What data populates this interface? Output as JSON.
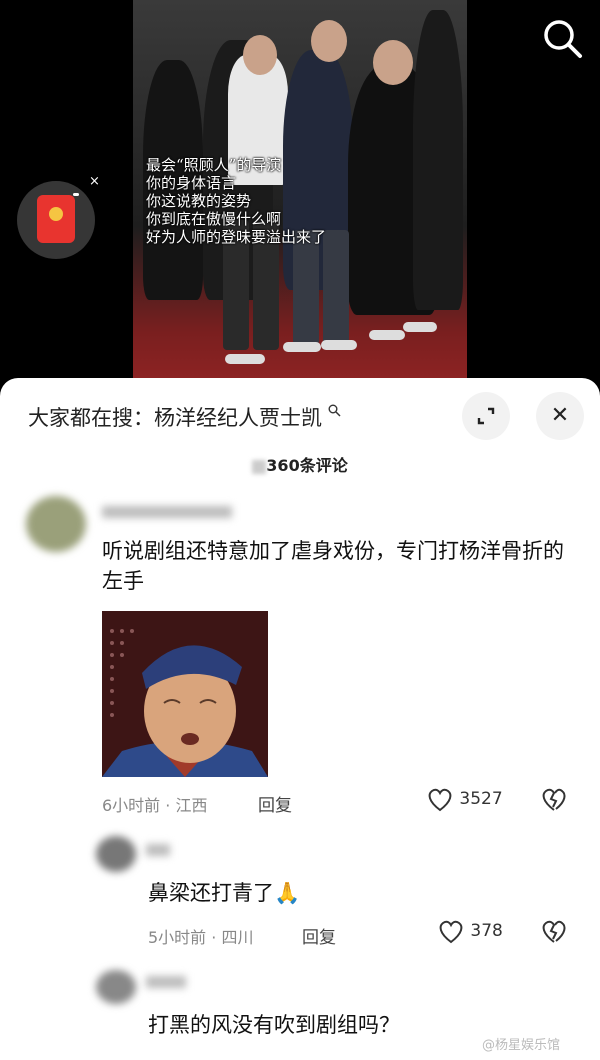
{
  "video": {
    "caption_lines": [
      "最会“照顾人”的导演",
      "你的身体语言",
      "你这说教的姿势",
      "你到底在傲慢什么啊",
      "好为人师的登味要溢出来了"
    ]
  },
  "overlay": {
    "search_icon": "search-icon",
    "red_packet_icon": "red-envelope-icon",
    "red_packet_close": "×"
  },
  "comments_panel": {
    "hot_search_prefix": "大家都在搜：",
    "hot_search_query": "杨洋经纪人贾士凯",
    "close_label": "✕",
    "count_text": "360条评论"
  },
  "comments": [
    {
      "text": "听说剧组还特意加了虐身戏份，专门打杨洋骨折的左手",
      "meta": "6小时前 · 江西",
      "reply_label": "回复",
      "likes": "3527",
      "has_image": true
    },
    {
      "text": "鼻梁还打青了🙏",
      "meta": "5小时前 · 四川",
      "reply_label": "回复",
      "likes": "378"
    },
    {
      "text": "打黑的风没有吹到剧组吗？"
    }
  ],
  "watermark": "@杨星娱乐馆"
}
